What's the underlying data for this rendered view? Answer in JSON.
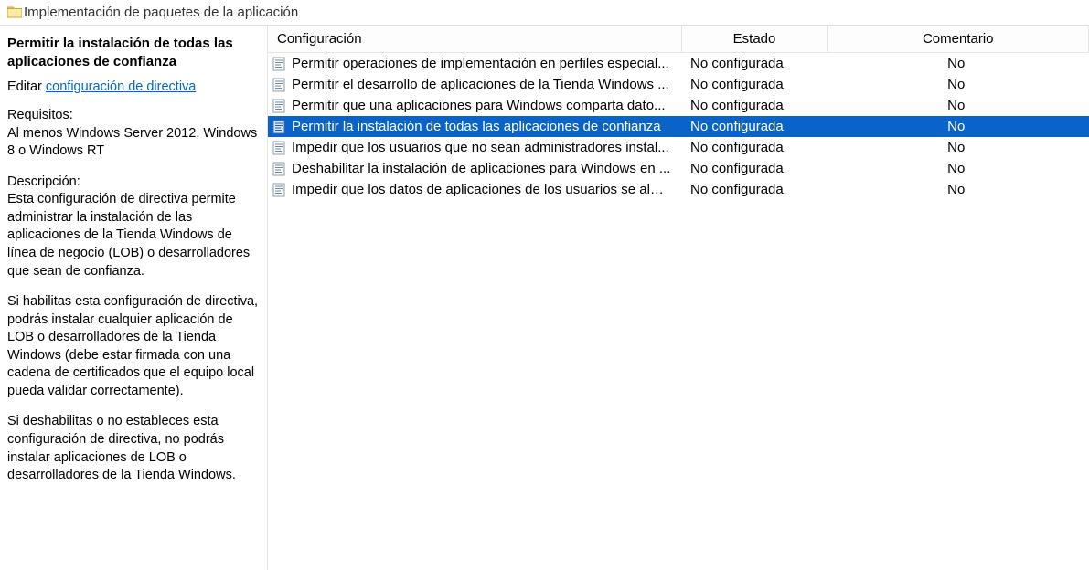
{
  "titlebar": {
    "title": "Implementación de paquetes  de la aplicación"
  },
  "side": {
    "heading": "Permitir la instalación de todas las aplicaciones de confianza",
    "edit_prefix": "Editar ",
    "edit_link": "configuración de directiva",
    "req_label": "Requisitos:",
    "req_body": "Al menos Windows Server 2012, Windows 8 o Windows RT",
    "desc_label": "Descripción:",
    "desc_p1": "Esta configuración de directiva permite administrar la instalación de las aplicaciones de la Tienda Windows de línea de negocio (LOB) o desarrolladores que sean de confianza.",
    "desc_p2": "Si habilitas esta configuración de directiva, podrás instalar cualquier aplicación de LOB o desarrolladores de la Tienda Windows (debe estar firmada con una cadena de certificados que el equipo local pueda validar correctamente).",
    "desc_p3": "Si deshabilitas o no estableces esta configuración de directiva, no podrás instalar aplicaciones de LOB o desarrolladores de la Tienda Windows."
  },
  "columns": {
    "config": "Configuración",
    "state": "Estado",
    "comment": "Comentario"
  },
  "rows": [
    {
      "name": "Permitir operaciones de implementación en perfiles especial...",
      "state": "No configurada",
      "comment": "No",
      "selected": false
    },
    {
      "name": "Permitir el desarrollo de aplicaciones de la Tienda Windows ...",
      "state": "No configurada",
      "comment": "No",
      "selected": false
    },
    {
      "name": "Permitir que una aplicaciones para Windows comparta dato...",
      "state": "No configurada",
      "comment": "No",
      "selected": false
    },
    {
      "name": "Permitir la instalación de todas las aplicaciones de confianza",
      "state": "No configurada",
      "comment": "No",
      "selected": true
    },
    {
      "name": "Impedir que los usuarios que no sean administradores instal...",
      "state": "No configurada",
      "comment": "No",
      "selected": false
    },
    {
      "name": "Deshabilitar la instalación de aplicaciones para Windows en ...",
      "state": "No configurada",
      "comment": "No",
      "selected": false
    },
    {
      "name": "Impedir que los datos de aplicaciones de los usuarios se alm...",
      "state": "No configurada",
      "comment": "No",
      "selected": false
    }
  ]
}
